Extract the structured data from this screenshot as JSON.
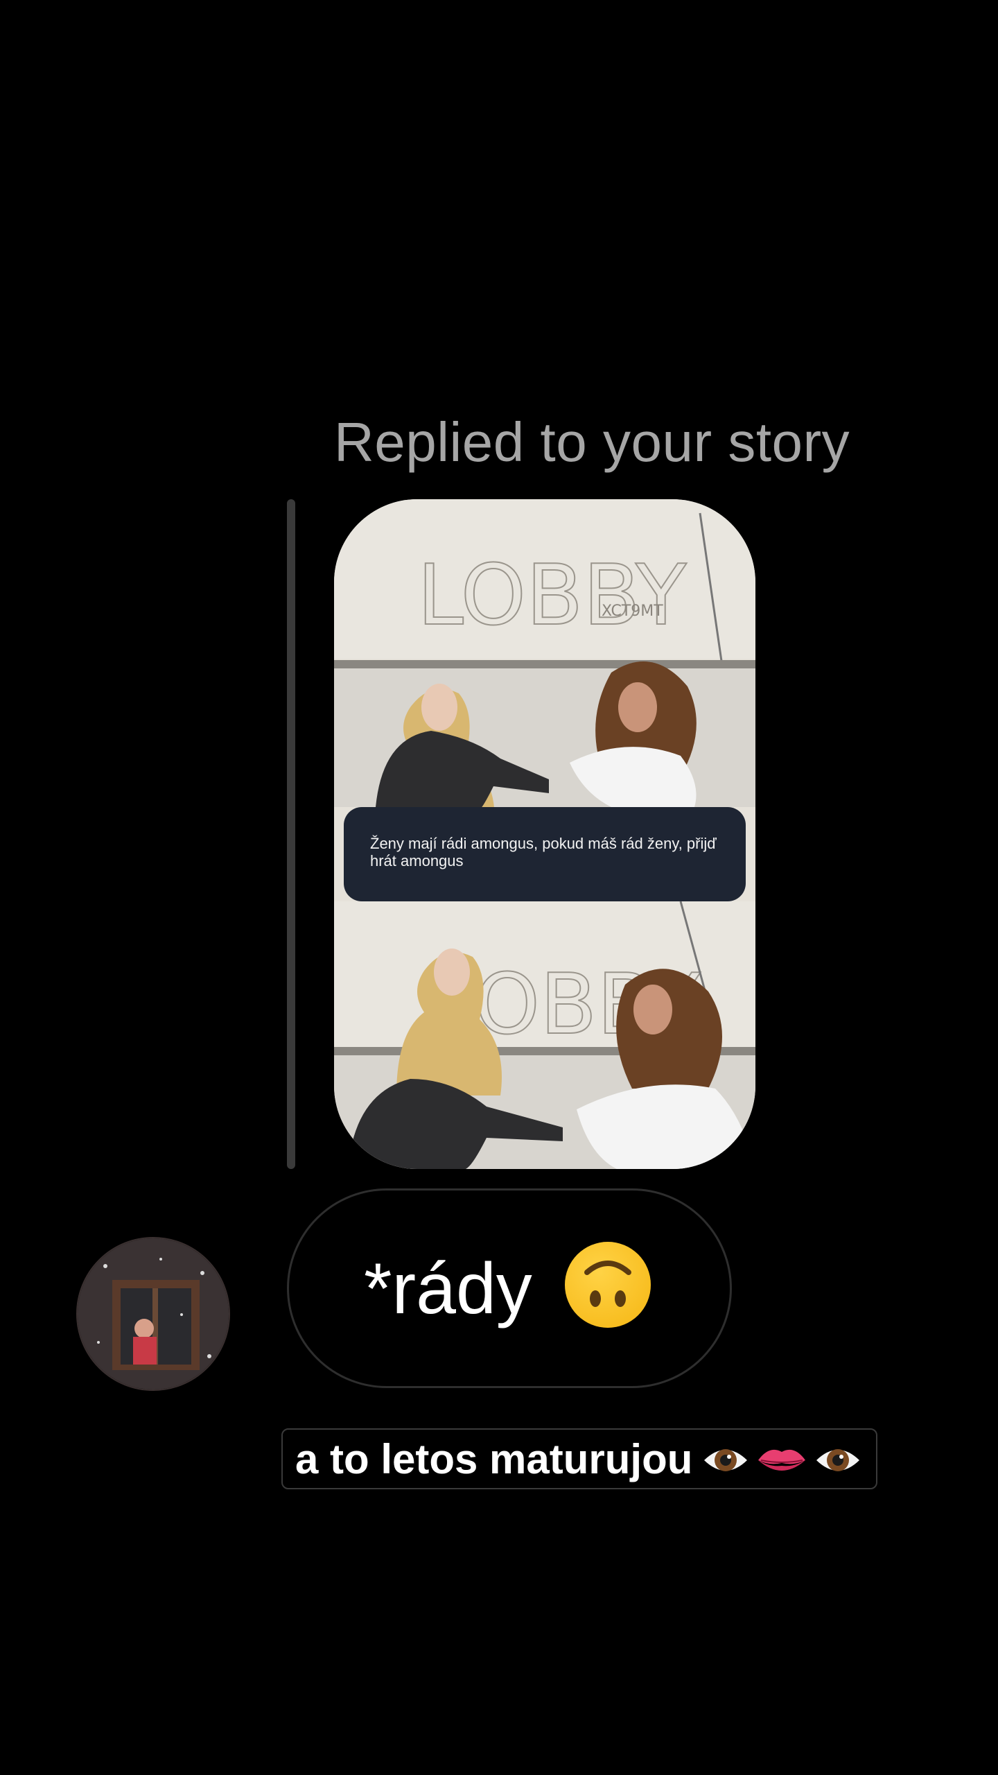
{
  "reply": {
    "header": "Replied to your story"
  },
  "story": {
    "whiteboard_text_top": "LOBBY",
    "whiteboard_tag": "XCT9MT",
    "question_text": "Ženy mají rádi amongus, pokud máš rád ženy, přijď hrát amongus"
  },
  "message": {
    "text": "*rády",
    "emoji": "upside-down-face-icon"
  },
  "caption": {
    "text": "a to letos maturujou",
    "emojis": [
      "eye-icon",
      "lips-icon",
      "eye-icon"
    ]
  },
  "colors": {
    "background": "#000000",
    "header_text": "#a6a6a6",
    "question_box": "#1e2533",
    "bubble_border": "#2e2e2e",
    "emoji_yellow": "#ffc727"
  }
}
